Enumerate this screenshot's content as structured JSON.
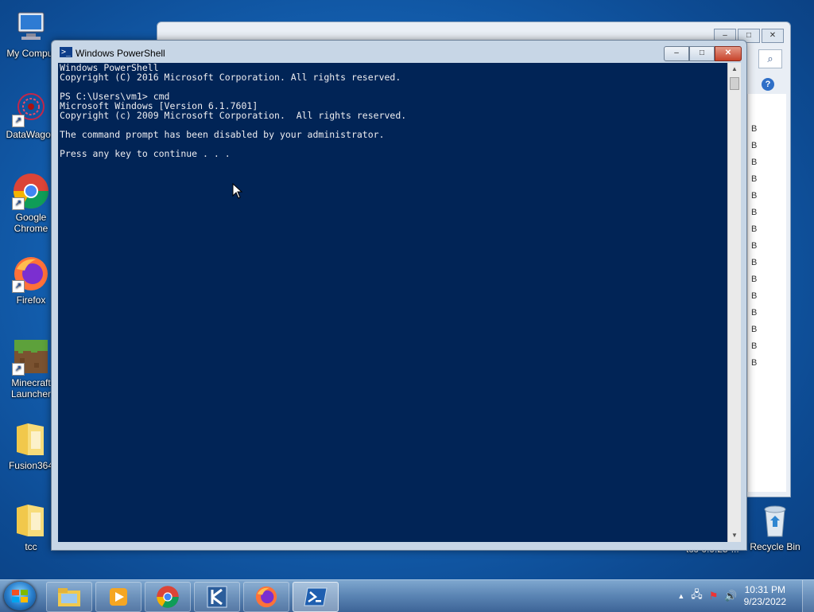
{
  "desktop": {
    "icons": [
      {
        "label": "My Comput",
        "name": "my-computer"
      },
      {
        "label": "DataWagon",
        "name": "datawagon"
      },
      {
        "label": "Google Chrome",
        "name": "google-chrome"
      },
      {
        "label": "Firefox",
        "name": "firefox"
      },
      {
        "label": "Minecraft Launcher",
        "name": "minecraft-launcher"
      },
      {
        "label": "Fusion364",
        "name": "fusion364"
      },
      {
        "label": "tcc",
        "name": "tcc"
      },
      {
        "label": "Recycle Bin",
        "name": "recycle-bin"
      }
    ],
    "partial_label": "tcc-0.9.25-...",
    "accent": "#1565b8"
  },
  "bg_window": {
    "caption": {
      "min": "–",
      "max": "□",
      "close": "✕"
    },
    "search_icon": "⌕",
    "help": "?",
    "list_letter": "B"
  },
  "powershell": {
    "title": "Windows PowerShell",
    "caption": {
      "min": "–",
      "max": "□",
      "close": "✕"
    },
    "lines": [
      "Windows PowerShell",
      "Copyright (C) 2016 Microsoft Corporation. All rights reserved.",
      "",
      "PS C:\\Users\\vm1> cmd",
      "Microsoft Windows [Version 6.1.7601]",
      "Copyright (c) 2009 Microsoft Corporation.  All rights reserved.",
      "",
      "The command prompt has been disabled by your administrator.",
      "",
      "Press any key to continue . . ."
    ],
    "bg_color": "#012456",
    "scroll_up": "▲",
    "scroll_down": "▼"
  },
  "taskbar": {
    "clock_time": "10:31 PM",
    "clock_date": "9/23/2022",
    "tray_chevron": "▲",
    "tray_network": "🖧",
    "tray_flag": "⚑",
    "tray_volume": "🔊"
  }
}
